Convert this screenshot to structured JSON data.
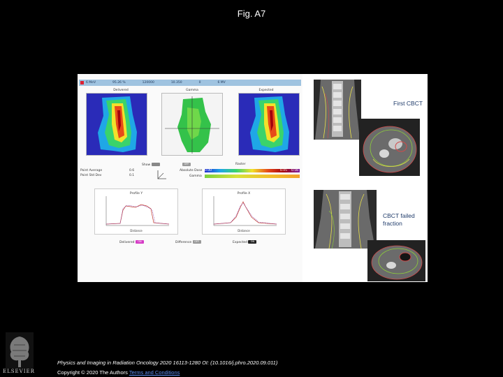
{
  "slide": {
    "title": "Fig. A7"
  },
  "app": {
    "header": [
      "6 MeV",
      "95.26 %",
      "120000",
      "10.350",
      "0",
      "6 MV"
    ],
    "panels": [
      "Delivered",
      "Gamma",
      "Expected"
    ],
    "views": {
      "show": "Show",
      "diff": "OFF",
      "raster": "Raster"
    },
    "stats": {
      "point_average_label": "Point Average",
      "point_average_value": "0.6",
      "point_std_label": "Point Std Dev",
      "point_std_value": "0.1",
      "absolute_dose": "Absolute Dose",
      "gamma": "Gamma",
      "dose_min": "0.00",
      "dose_mid": "0.05",
      "dose_max": "0.56"
    },
    "profile_y": {
      "title": "Profile Y",
      "xlabel": "Distance"
    },
    "profile_x": {
      "title": "Profile X",
      "xlabel": "Distance"
    },
    "toggles": {
      "delivered": "Delivered",
      "delivered_state": "ON",
      "difference": "Difference",
      "difference_state": "OFF",
      "expected": "Expected",
      "expected_state": "ON"
    }
  },
  "labels": {
    "first": "First CBCT",
    "failed_1": "CBCT failed",
    "failed_2": "fraction"
  },
  "footer": {
    "citation": "Physics and Imaging in Radiation Oncology 2020 16113-1280 OI: (10.1016/j.phro.2020.09.011)",
    "copyright": "Copyright © 2020 The Authors",
    "license_link": "Terms and Conditions",
    "publisher": "ELSEVIER"
  },
  "colors": {
    "background": "#000000",
    "cbct_label": "#1f3b6a",
    "link": "#5b8df0"
  }
}
